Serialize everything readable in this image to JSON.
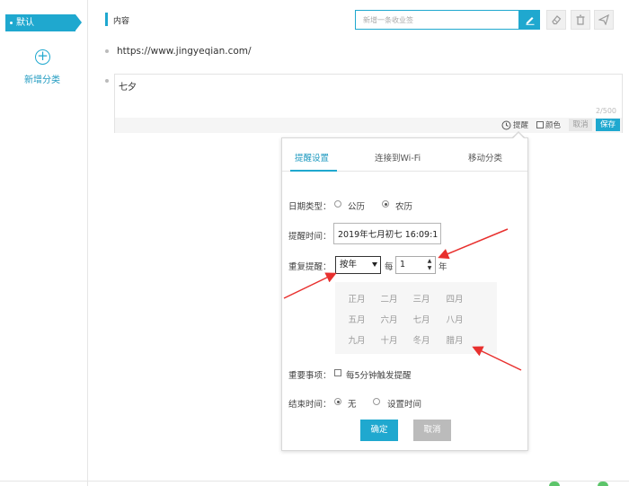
{
  "sidebar": {
    "default_category": "默认",
    "add_category": "新增分类"
  },
  "header": {
    "title": "内容",
    "bookmark_placeholder": "新增一条收业签"
  },
  "notes": {
    "url": "https://www.jingyeqian.com/",
    "draft_text": "七夕",
    "char_count": "2/500",
    "remind_label": "提醒",
    "color_label": "颜色",
    "cancel_label": "取消",
    "save_label": "保存"
  },
  "panel": {
    "tabs": [
      "提醒设置",
      "连接到Wi-Fi",
      "移动分类"
    ],
    "active_tab": 0,
    "date_type_label": "日期类型：",
    "date_type_options": [
      "公历",
      "农历"
    ],
    "date_type_selected": "农历",
    "remind_time_label": "提醒时间：",
    "remind_time_value": "2019年七月初七 16:09:1",
    "repeat_label": "重复提醒：",
    "repeat_select": "按年",
    "every_label": "每",
    "every_value": "1",
    "unit_label": "年",
    "months": [
      "正月",
      "二月",
      "三月",
      "四月",
      "五月",
      "六月",
      "七月",
      "八月",
      "九月",
      "十月",
      "冬月",
      "腊月"
    ],
    "important_label": "重要事项：",
    "important_checkbox_label": "每5分钟触发提醒",
    "important_checked": false,
    "end_time_label": "结束时间：",
    "end_options": [
      "无",
      "设置时间"
    ],
    "end_selected": "无",
    "confirm_label": "确定",
    "cancel_label": "取消"
  },
  "colors": {
    "accent": "#1fa8cf",
    "annotation_arrow": "#e8302e"
  },
  "icons": {
    "edit": "pencil-icon",
    "clear": "eraser-icon",
    "delete": "trash-icon",
    "send": "send-icon",
    "remind": "clock-icon",
    "add_category": "plus-circle-icon"
  }
}
